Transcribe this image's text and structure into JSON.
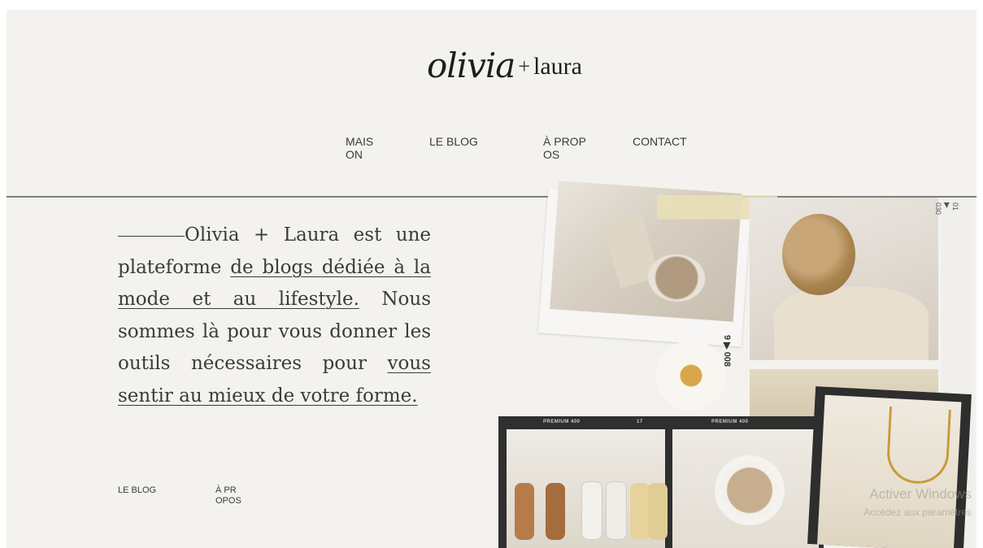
{
  "brand": {
    "script": "olivia",
    "plus": "+",
    "word": "laura"
  },
  "nav": {
    "maison": "MAISON",
    "blog": "LE BLOG",
    "apropos": "À PROPOS",
    "contact": "CONTACT"
  },
  "intro": {
    "t1": "Olivia + Laura est une plateforme ",
    "link1": "de blogs dédiée à la mode et au lifestyle.",
    "t2": " Nous sommes là pour vous donner les outils nécessaires pour ",
    "link2": "vous sentir au mieux de votre forme."
  },
  "footer": {
    "blog": "LE BLOG",
    "apropos": "À PROPOS"
  },
  "collage": {
    "film_header_1": "PREMIUM 400",
    "film_header_num": "17",
    "film_header_2": "PREMIUM 400",
    "strip_text": "01 ▶ 030",
    "side_text": "9 ▶ 008"
  },
  "watermark": {
    "line1": "Activer Windows",
    "line2": "Accédez aux paramètres"
  },
  "colors": {
    "background": "#f4f2ee",
    "text": "#3b3b3b",
    "divider": "#7d7d7d"
  }
}
